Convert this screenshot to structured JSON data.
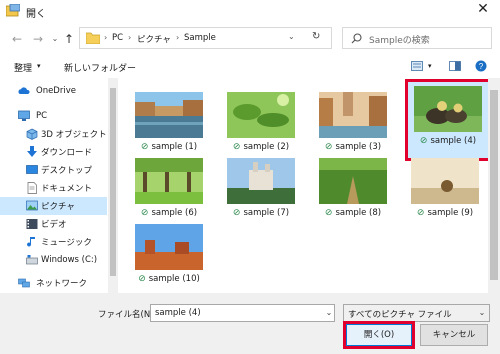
{
  "window": {
    "title": "開く"
  },
  "nav": {
    "breadcrumb": [
      "PC",
      "ピクチャ",
      "Sample"
    ],
    "search_placeholder": "Sampleの検索"
  },
  "toolbar": {
    "organize": "整理",
    "new_folder": "新しいフォルダー"
  },
  "sidebar": {
    "items": [
      {
        "label": "OneDrive",
        "icon": "cloud-icon"
      },
      {
        "label": "PC",
        "icon": "computer-icon"
      },
      {
        "label": "3D オブジェクト",
        "icon": "cube-icon"
      },
      {
        "label": "ダウンロード",
        "icon": "download-icon"
      },
      {
        "label": "デスクトップ",
        "icon": "desktop-icon"
      },
      {
        "label": "ドキュメント",
        "icon": "document-icon"
      },
      {
        "label": "ピクチャ",
        "icon": "pictures-icon"
      },
      {
        "label": "ビデオ",
        "icon": "video-icon"
      },
      {
        "label": "ミュージック",
        "icon": "music-icon"
      },
      {
        "label": "Windows (C:)",
        "icon": "drive-icon"
      },
      {
        "label": "ネットワーク",
        "icon": "network-icon"
      }
    ]
  },
  "files": [
    {
      "name": "sample (1)"
    },
    {
      "name": "sample (2)"
    },
    {
      "name": "sample (3)"
    },
    {
      "name": "sample (4)"
    },
    {
      "name": "sample (6)"
    },
    {
      "name": "sample (7)"
    },
    {
      "name": "sample (8)"
    },
    {
      "name": "sample (9)"
    },
    {
      "name": "sample (10)"
    }
  ],
  "footer": {
    "filename_label": "ファイル名(N):",
    "filename_value": "sample (4)",
    "filetype": "すべてのピクチャ ファイル",
    "open_button": "開く(O)",
    "cancel_button": "キャンセル"
  }
}
